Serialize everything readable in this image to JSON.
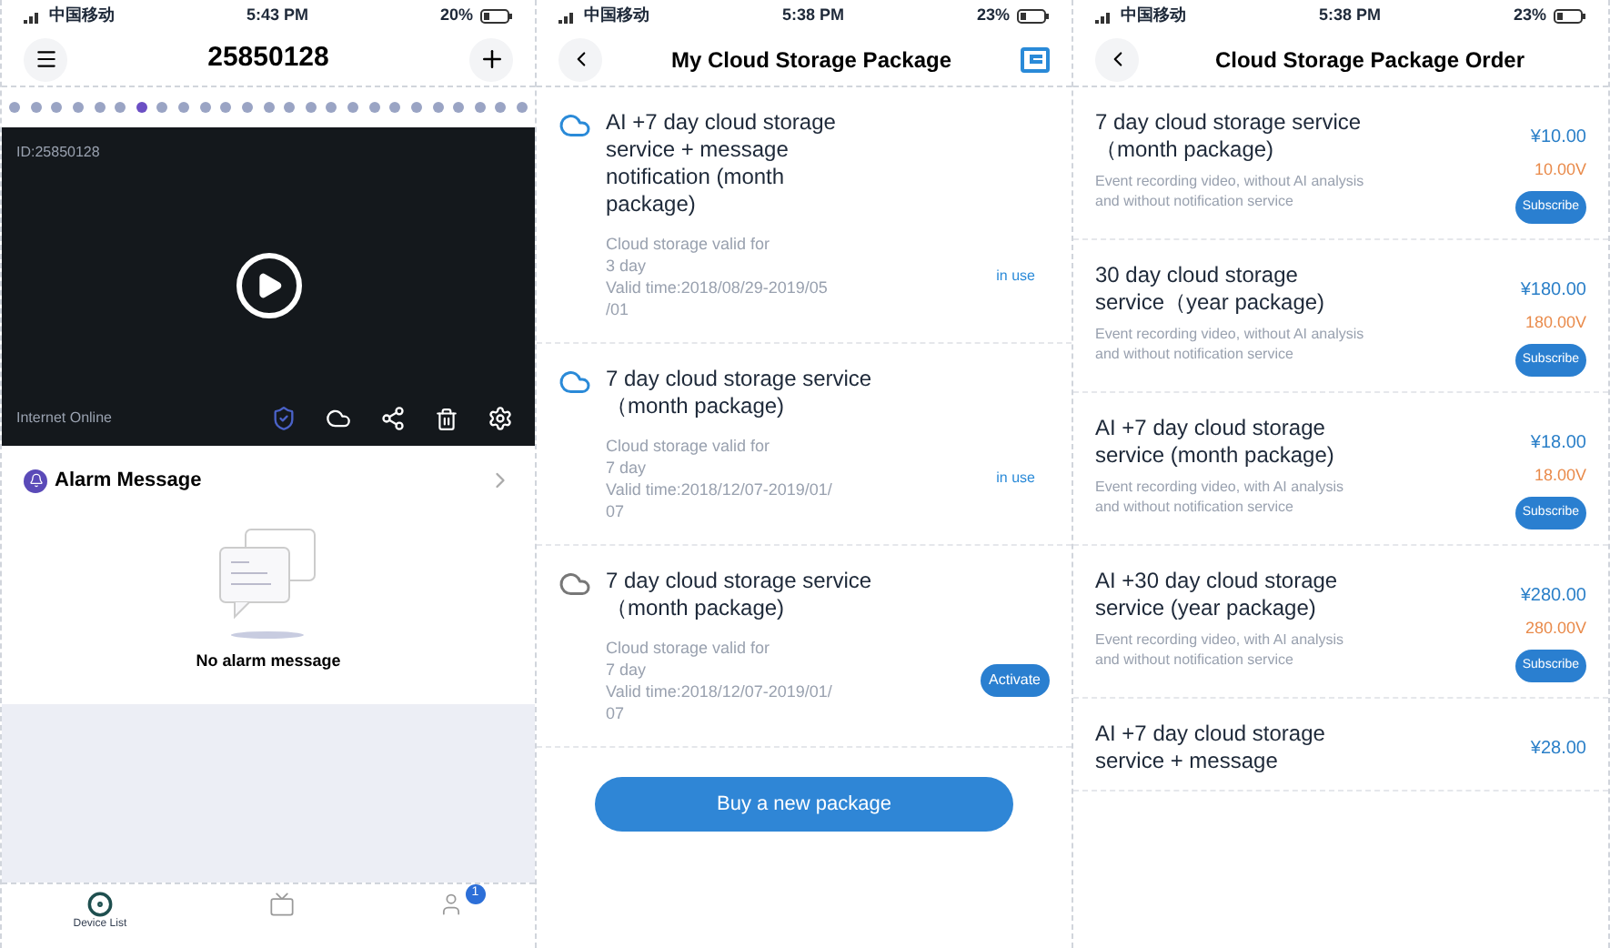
{
  "screens": [
    {
      "status_bar": {
        "carrier": "中国移动",
        "time": "5:43 PM",
        "battery": "20%"
      },
      "header": {
        "title": "25850128"
      },
      "pager": {
        "dots": [
          {
            "selected": false
          },
          {
            "selected": false
          },
          {
            "selected": false
          },
          {
            "selected": false
          },
          {
            "selected": false
          },
          {
            "selected": false
          },
          {
            "selected": true
          },
          {
            "selected": false
          },
          {
            "selected": false
          },
          {
            "selected": false
          },
          {
            "selected": false
          },
          {
            "selected": false
          },
          {
            "selected": false
          },
          {
            "selected": false
          },
          {
            "selected": false
          },
          {
            "selected": false
          },
          {
            "selected": false
          },
          {
            "selected": false
          },
          {
            "selected": false
          },
          {
            "selected": false
          },
          {
            "selected": false
          },
          {
            "selected": false
          },
          {
            "selected": false
          },
          {
            "selected": false
          },
          {
            "selected": false
          }
        ]
      },
      "video": {
        "device_id": "ID:25850128",
        "connection": "Internet Online"
      },
      "alarm": {
        "title": "Alarm Message",
        "empty_text": "No alarm message"
      },
      "tab_bar": [
        {
          "label": "Device List",
          "selected": true
        },
        {
          "selected": false
        },
        {
          "selected": false,
          "badge": "1"
        }
      ]
    },
    {
      "status_bar": {
        "carrier": "中国移动",
        "time": "5:38 PM",
        "battery": "23%"
      },
      "header": {
        "title": "My Cloud Storage Package"
      },
      "packages": [
        {
          "title": "AI +7 day cloud storage service + message notification (month package)",
          "active": true,
          "details": [
            "Cloud storage valid for",
            "3 day",
            "Valid time:2018/08/29-2019/05",
            "/01"
          ],
          "status": {
            "kind": "label",
            "text": "in use"
          }
        },
        {
          "title": "7 day cloud storage service（month package)",
          "active": true,
          "details": [
            "Cloud storage valid for",
            "7 day",
            "Valid time:2018/12/07-2019/01/",
            "07"
          ],
          "status": {
            "kind": "label",
            "text": "in use"
          }
        },
        {
          "title": "7 day cloud storage service（month package)",
          "active": false,
          "details": [
            "Cloud storage valid for",
            "7 day",
            "Valid time:2018/12/07-2019/01/",
            "07"
          ],
          "status": {
            "kind": "button",
            "text": "Activate"
          }
        }
      ],
      "buy_button": "Buy a new package"
    },
    {
      "status_bar": {
        "carrier": "中国移动",
        "time": "5:38 PM",
        "battery": "23%"
      },
      "header": {
        "title": "Cloud Storage Package Order"
      },
      "offers": [
        {
          "title": "7 day cloud storage service（month package)",
          "description": "Event recording video, without AI analysis and without  notification service",
          "price": "¥10.00",
          "alt_price": "10.00V",
          "button": "Subscribe"
        },
        {
          "title": "30 day cloud storage service（year package)",
          "description": "Event recording video, without AI analysis and without  notification service",
          "price": "¥180.00",
          "alt_price": "180.00V",
          "button": "Subscribe"
        },
        {
          "title": "AI +7 day cloud storage service (month package)",
          "description": "Event recording video, with AI analysis and without  notification service",
          "price": "¥18.00",
          "alt_price": "18.00V",
          "button": "Subscribe"
        },
        {
          "title": "AI +30 day cloud storage service (year package)",
          "description": "Event recording video, with AI analysis and without  notification service",
          "price": "¥280.00",
          "alt_price": "280.00V",
          "button": "Subscribe"
        },
        {
          "title": "AI +7 day cloud storage service + message",
          "price": "¥28.00"
        }
      ]
    }
  ]
}
